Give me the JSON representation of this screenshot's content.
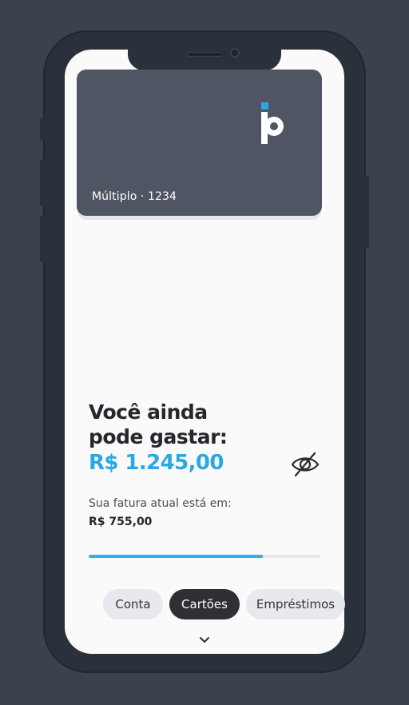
{
  "card": {
    "label": "Múltiplo · 1234",
    "logo_icon": "brand-p-logo-icon",
    "accent_color": "#2aa8e4"
  },
  "balance": {
    "heading": "Você ainda pode gastar:",
    "amount": "R$ 1.245,00",
    "visibility_icon": "eye-off-icon"
  },
  "invoice": {
    "label": "Sua fatura atual está em:",
    "value": "R$ 755,00",
    "progress_fraction": 0.75
  },
  "tabs": [
    {
      "label": "Conta",
      "selected": false
    },
    {
      "label": "Cartões",
      "selected": true
    },
    {
      "label": "Empréstimos",
      "selected": false
    }
  ],
  "footer": {
    "chevron_icon": "chevron-down-icon"
  }
}
